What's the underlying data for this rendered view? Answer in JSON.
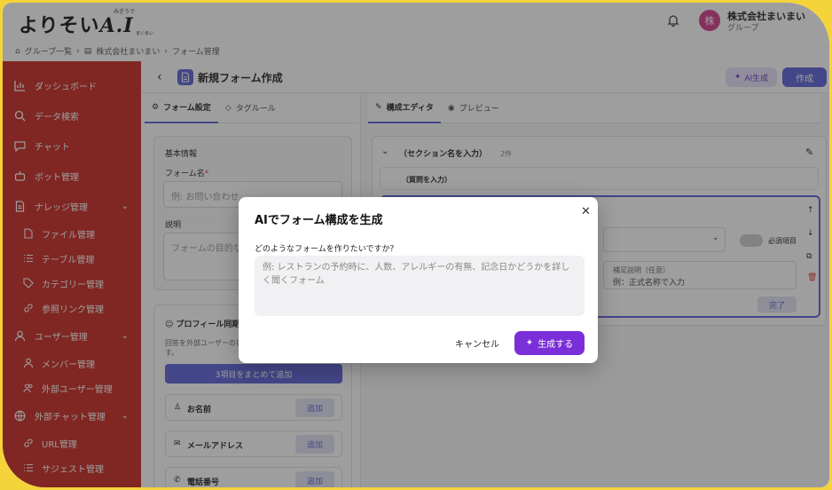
{
  "app": {
    "logo_text": "よりそい",
    "logo_ai": "A.I",
    "logo_ruby": "みぎうで",
    "logo_sub": "まいまい",
    "org_name": "株式会社まいまい",
    "org_sub": "グループ",
    "avatar_char": "株"
  },
  "breadcrumb": [
    "グループ一覧",
    "株式会社まいまい",
    "フォーム管理"
  ],
  "sidebar": {
    "items": [
      {
        "label": "ダッシュボード",
        "icon": "bar-chart-icon",
        "sub": false
      },
      {
        "label": "データ検索",
        "icon": "search-icon",
        "sub": false
      },
      {
        "label": "チャット",
        "icon": "chat-icon",
        "sub": false
      },
      {
        "label": "ボット管理",
        "icon": "bot-icon",
        "sub": false
      },
      {
        "label": "ナレッジ管理",
        "icon": "document-icon",
        "sub": false,
        "expandable": true
      },
      {
        "label": "ファイル管理",
        "icon": "file-icon",
        "sub": true
      },
      {
        "label": "テーブル管理",
        "icon": "list-icon",
        "sub": true
      },
      {
        "label": "カテゴリー管理",
        "icon": "tag-icon",
        "sub": true
      },
      {
        "label": "参照リンク管理",
        "icon": "link-icon",
        "sub": true
      },
      {
        "label": "ユーザー管理",
        "icon": "user-icon",
        "sub": false,
        "expandable": true
      },
      {
        "label": "メンバー管理",
        "icon": "user-icon",
        "sub": true
      },
      {
        "label": "外部ユーザー管理",
        "icon": "users-icon",
        "sub": true
      },
      {
        "label": "外部チャット管理",
        "icon": "globe-icon",
        "sub": false,
        "expandable": true
      },
      {
        "label": "URL管理",
        "icon": "link-icon",
        "sub": true
      },
      {
        "label": "サジェスト管理",
        "icon": "list-icon",
        "sub": true
      }
    ]
  },
  "page": {
    "title": "新規フォーム作成",
    "ai_button": "AI生成",
    "create_button": "作成"
  },
  "left_tabs": [
    "フォーム設定",
    "タグルール"
  ],
  "basic_info": {
    "heading": "基本情報",
    "name_label": "フォーム名",
    "required_mark": "*",
    "name_placeholder": "例: お問い合わせ",
    "desc_label": "説明",
    "desc_placeholder": "フォームの目的な"
  },
  "profile_sync": {
    "heading": "プロフィール同期",
    "desc": "回答を外部ユーザーの名",
    "desc2": "す。",
    "bulk_button": "3項目をまとめて追加",
    "fields": [
      {
        "label": "お名前",
        "icon": "user-icon",
        "button": "追加"
      },
      {
        "label": "メールアドレス",
        "icon": "mail-icon",
        "button": "追加"
      },
      {
        "label": "電話番号",
        "icon": "phone-icon",
        "button": "追加"
      }
    ]
  },
  "right_tabs": [
    "構成エディタ",
    "プレビュー"
  ],
  "section": {
    "title": "（セクション名を入力）",
    "count": "2件",
    "question_placeholder": "（質問を入力）",
    "required_label": "必須項目",
    "hint_label": "補足説明（任意）",
    "hint_value": "例：正式名称で入力",
    "done_button": "完了"
  },
  "modal": {
    "title": "AIでフォーム構成を生成",
    "question": "どのようなフォームを作りたいですか？",
    "placeholder": "例: レストランの予約時に、人数、アレルギーの有無、記念日かどうかを詳しく聞くフォーム",
    "cancel": "キャンセル",
    "generate": "生成する"
  },
  "colors": {
    "sidebar": "#c8271f",
    "primary": "#5a5fd8",
    "generate": "#7b2fd8",
    "frame": "#f4d43a"
  }
}
